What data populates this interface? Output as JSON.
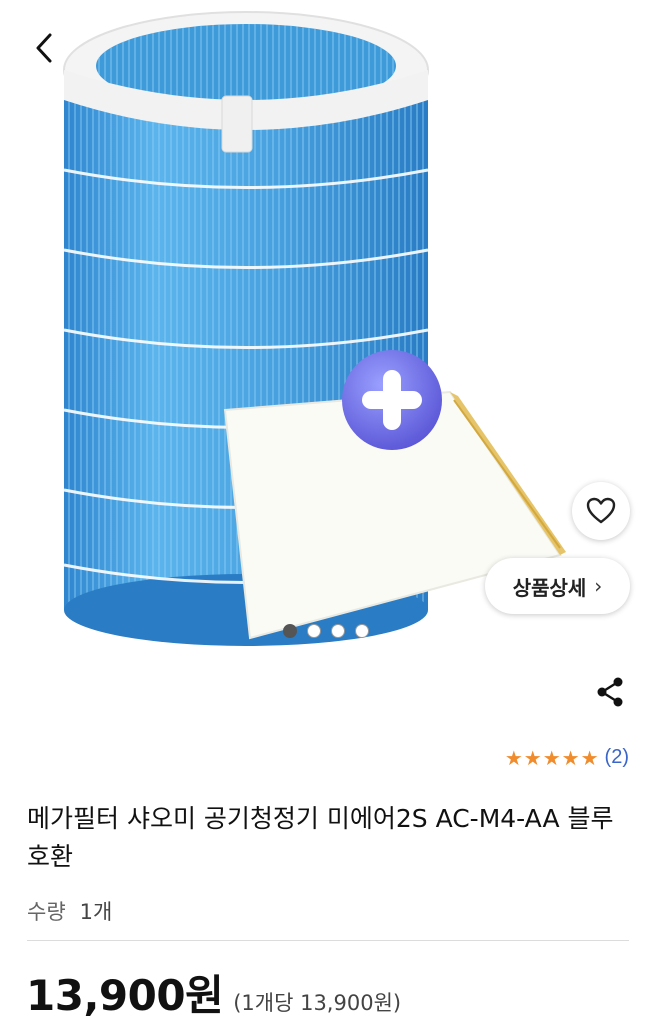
{
  "product": {
    "title": "메가필터 샤오미 공기청정기 미에어2S AC-M4-AA 블루 호환",
    "quantity_label": "수량",
    "quantity_value": "1개",
    "price": "13,900원",
    "unit_price": "(1개당 13,900원)",
    "rating_stars": 5,
    "review_count": "(2)"
  },
  "buttons": {
    "detail_label": "상품상세",
    "detail_chevron": "›"
  },
  "gallery": {
    "image_count": 4,
    "active_index": 0
  },
  "icons": {
    "back": "chevron-left-icon",
    "favorite": "heart-outline-icon",
    "share": "share-icon",
    "star": "star-icon"
  },
  "colors": {
    "star": "#f08c2c",
    "review_link": "#3a66c9",
    "filter_blue": "#4aa3e0",
    "plus_badge": "#6a6fe6"
  }
}
